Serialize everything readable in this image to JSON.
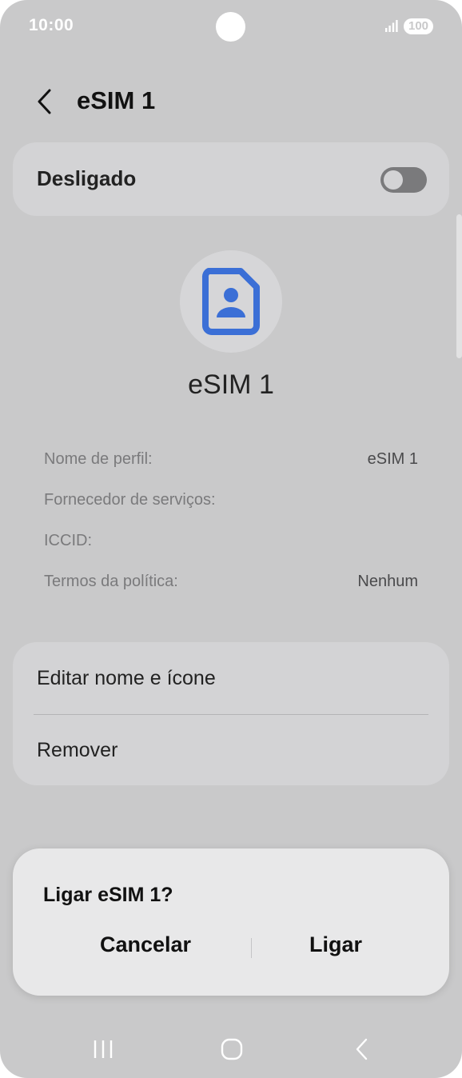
{
  "status_bar": {
    "time": "10:00",
    "battery": "100",
    "icons": [
      "signal-icon",
      "battery-icon"
    ]
  },
  "header": {
    "title": "eSIM 1",
    "back_icon": "back-arrow-icon"
  },
  "toggle": {
    "label": "Desligado",
    "state": "off"
  },
  "profile": {
    "icon": "sim-card-person-icon",
    "name": "eSIM 1",
    "accent_color": "#3b6fd6"
  },
  "info": [
    {
      "label": "Nome de perfil:",
      "value": "eSIM 1"
    },
    {
      "label": "Fornecedor de serviços:",
      "value": ""
    },
    {
      "label": "ICCID:",
      "value": ""
    },
    {
      "label": "Termos da política:",
      "value": "Nenhum"
    }
  ],
  "actions": {
    "edit_label": "Editar nome e ícone",
    "remove_label": "Remover"
  },
  "dialog": {
    "title": "Ligar eSIM 1?",
    "cancel_label": "Cancelar",
    "confirm_label": "Ligar"
  },
  "nav_bar": {
    "icons": [
      "recents-icon",
      "home-icon",
      "back-icon"
    ]
  }
}
